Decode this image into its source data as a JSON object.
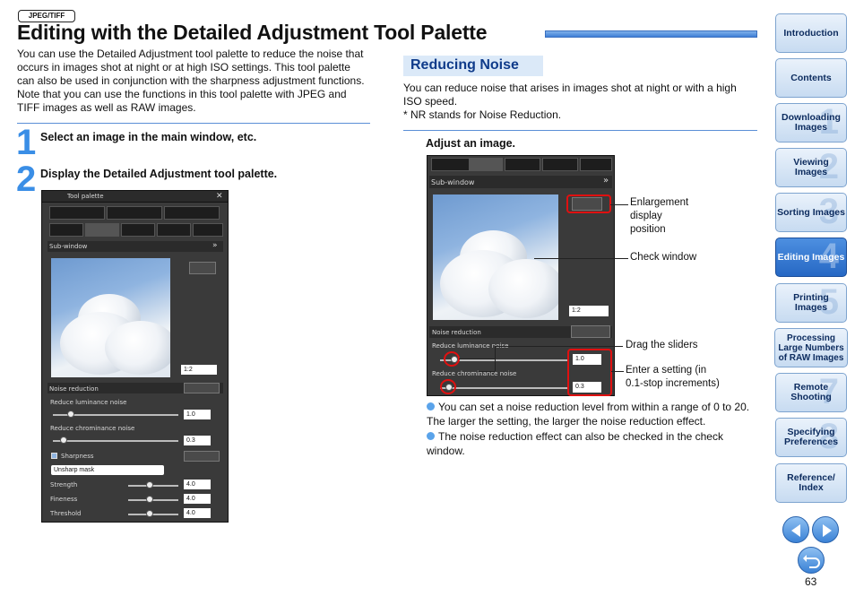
{
  "badge": "JPEG/TIFF",
  "title": "Editing with the Detailed Adjustment Tool Palette",
  "intro": "You can use the Detailed Adjustment tool palette to reduce the noise that occurs in images shot at night or at high ISO settings. This tool palette can also be used in conjunction with the sharpness adjustment functions. Note that you can use the functions in this tool palette with JPEG and TIFF images as well as RAW images.",
  "steps": [
    {
      "num": "1",
      "label": "Select an image in the main window, etc."
    },
    {
      "num": "2",
      "label": "Display the Detailed Adjustment tool palette."
    }
  ],
  "palette": {
    "title": "Tool palette",
    "close": "✕",
    "subwindow": "Sub-window",
    "zoom": "1:2",
    "noise_reduction": "Noise reduction",
    "luminance": "Reduce luminance noise",
    "chrominance": "Reduce chrominance noise",
    "lum_value": "1.0",
    "chrom_value": "0.3",
    "sharpness": "Sharpness",
    "sharp_mode": "Unsharp mask",
    "strength": "Strength",
    "fineness": "Fineness",
    "threshold": "Threshold",
    "strength_value": "4.0",
    "fineness_value": "4.0",
    "threshold_value": "4.0"
  },
  "section": {
    "heading": "Reducing Noise",
    "text": "You can reduce noise that arises in images shot at night or with a high ISO speed.",
    "note": "* NR stands for Noise Reduction.",
    "adjust": "Adjust an image."
  },
  "callouts": {
    "enlargement": [
      "Enlargement",
      "display",
      "position"
    ],
    "check_window": "Check window",
    "drag": "Drag the sliders",
    "enter": [
      "Enter a setting (in",
      "0.1-stop increments)"
    ]
  },
  "bullets": [
    "You can set a noise reduction level from within a range of 0 to 20. The larger the setting, the larger the noise reduction effect.",
    "The noise reduction effect can also be checked in the check window."
  ],
  "nav": [
    {
      "label": "Introduction",
      "num": ""
    },
    {
      "label": "Contents",
      "num": ""
    },
    {
      "label": "Downloading Images",
      "num": "1"
    },
    {
      "label": "Viewing Images",
      "num": "2"
    },
    {
      "label": "Sorting Images",
      "num": "3"
    },
    {
      "label": "Editing Images",
      "num": "4"
    },
    {
      "label": "Printing Images",
      "num": "5"
    },
    {
      "label": "Processing Large Numbers of RAW Images",
      "num": ""
    },
    {
      "label": "Remote Shooting",
      "num": "7"
    },
    {
      "label": "Specifying Preferences",
      "num": "8"
    },
    {
      "label": "Reference/ Index",
      "num": ""
    }
  ],
  "page_number": "63",
  "colors": {
    "accent": "#3a8ee6",
    "active_nav": "#2668c4",
    "highlight": "#e01010"
  }
}
